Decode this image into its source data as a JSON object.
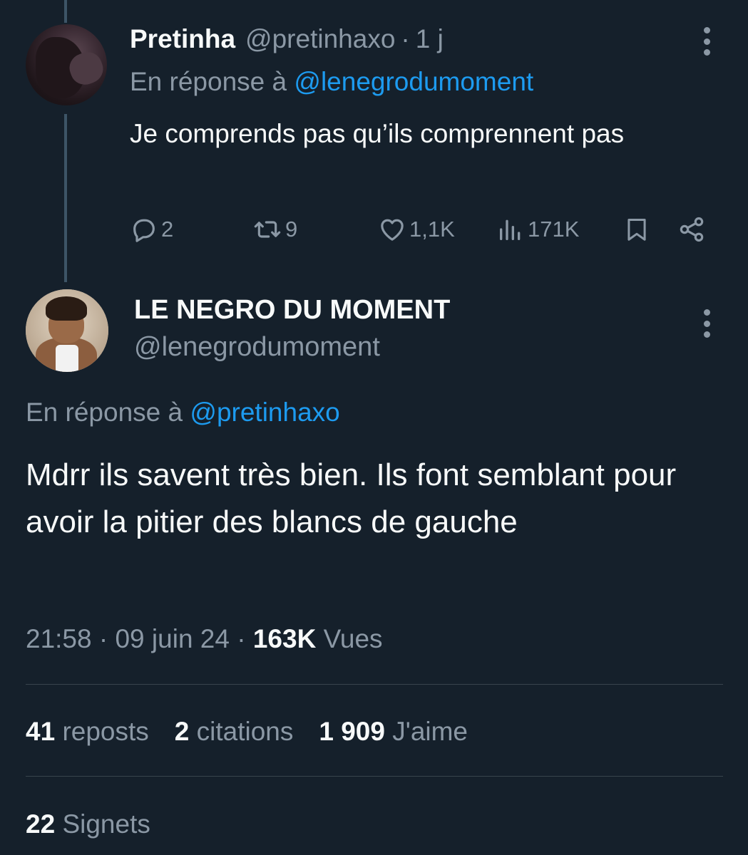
{
  "reply_tweet": {
    "display_name": "Pretinha",
    "handle": "@pretinhaxo",
    "separator": "·",
    "time": "1 j",
    "reply_prefix": "En réponse à",
    "reply_mention": "@lenegrodumoment",
    "text": "Je comprends pas qu’ils comprennent pas",
    "counts": {
      "replies": "2",
      "reposts": "9",
      "likes": "1,1K",
      "views": "171K"
    },
    "icons": [
      "reply-icon",
      "repost-icon",
      "like-icon",
      "views-icon",
      "bookmark-icon",
      "share-icon",
      "more-icon"
    ]
  },
  "main_tweet": {
    "display_name": "LE NEGRO DU MOMENT",
    "handle": "@lenegrodumoment",
    "reply_prefix": "En réponse à",
    "reply_mention": "@pretinhaxo",
    "text": "Mdrr ils savent très bien. Ils font semblant pour avoir la pitier des blancs de gauche",
    "meta": {
      "time": "21:58",
      "separator": "·",
      "date": "09 juin 24",
      "views_count": "163K",
      "views_label": "Vues"
    },
    "stats": {
      "reposts_count": "41",
      "reposts_label": "reposts",
      "quotes_count": "2",
      "quotes_label": "citations",
      "likes_count": "1 909",
      "likes_label": "J'aime",
      "bookmarks_count": "22",
      "bookmarks_label": "Signets"
    }
  },
  "colors": {
    "background": "#15202b",
    "text_primary": "#f7f9f9",
    "text_secondary": "#8b98a5",
    "accent": "#1d9bf0",
    "divider": "#38444d"
  }
}
